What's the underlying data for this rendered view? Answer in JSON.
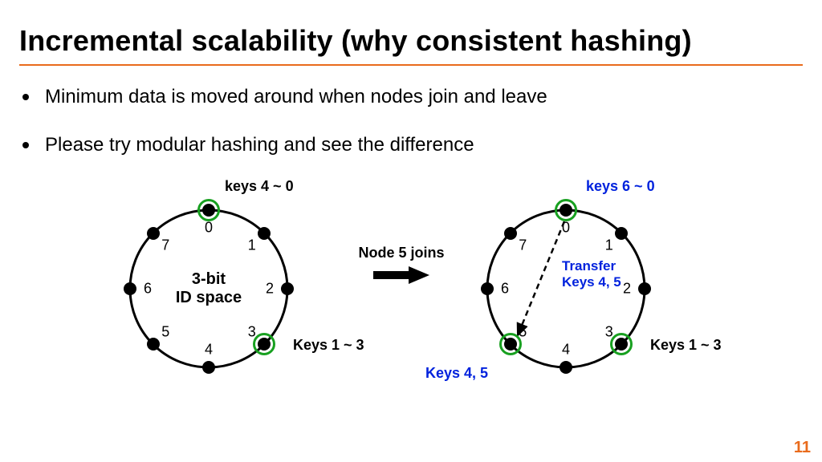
{
  "title": "Incremental scalability (why consistent hashing)",
  "bullets": [
    "Minimum data is moved around when nodes join and leave",
    "Please try modular hashing and see the difference"
  ],
  "arrow_caption": "Node 5 joins",
  "page_number": "11",
  "ring_left": {
    "center_label": "3-bit\nID space",
    "top_annotation": "keys 4 ~ 0",
    "nodes": [
      {
        "id": 0,
        "boxed": true
      },
      {
        "id": 1,
        "boxed": false
      },
      {
        "id": 2,
        "boxed": false
      },
      {
        "id": 3,
        "boxed": true
      },
      {
        "id": 4,
        "boxed": false
      },
      {
        "id": 5,
        "boxed": false
      },
      {
        "id": 6,
        "boxed": false
      },
      {
        "id": 7,
        "boxed": false
      }
    ],
    "node3_annotation": "Keys 1 ~ 3"
  },
  "ring_right": {
    "top_annotation": "keys 6 ~ 0",
    "transfer_label": "Transfer\nKeys 4, 5",
    "nodes": [
      {
        "id": 0,
        "boxed": true
      },
      {
        "id": 1,
        "boxed": false
      },
      {
        "id": 2,
        "boxed": false
      },
      {
        "id": 3,
        "boxed": true
      },
      {
        "id": 4,
        "boxed": false
      },
      {
        "id": 5,
        "boxed": true
      },
      {
        "id": 6,
        "boxed": false
      },
      {
        "id": 7,
        "boxed": false
      }
    ],
    "node3_annotation": "Keys 1 ~ 3",
    "node5_annotation": "Keys 4, 5"
  },
  "chart_data": {
    "type": "diagram",
    "description": "Two 8-position consistent-hash rings (3-bit ID space) illustrating key reassignment when node 5 joins.",
    "id_space_bits": 3,
    "positions": [
      0,
      1,
      2,
      3,
      4,
      5,
      6,
      7
    ],
    "before": {
      "active_nodes": [
        0,
        3
      ],
      "key_ranges": [
        {
          "node": 0,
          "keys": "4 ~ 0"
        },
        {
          "node": 3,
          "keys": "1 ~ 3"
        }
      ]
    },
    "event": "Node 5 joins",
    "after": {
      "active_nodes": [
        0,
        3,
        5
      ],
      "key_ranges": [
        {
          "node": 0,
          "keys": "6 ~ 0"
        },
        {
          "node": 3,
          "keys": "1 ~ 3"
        },
        {
          "node": 5,
          "keys": "4, 5"
        }
      ],
      "transfer": {
        "from": 0,
        "to": 5,
        "keys": "4, 5"
      }
    }
  }
}
